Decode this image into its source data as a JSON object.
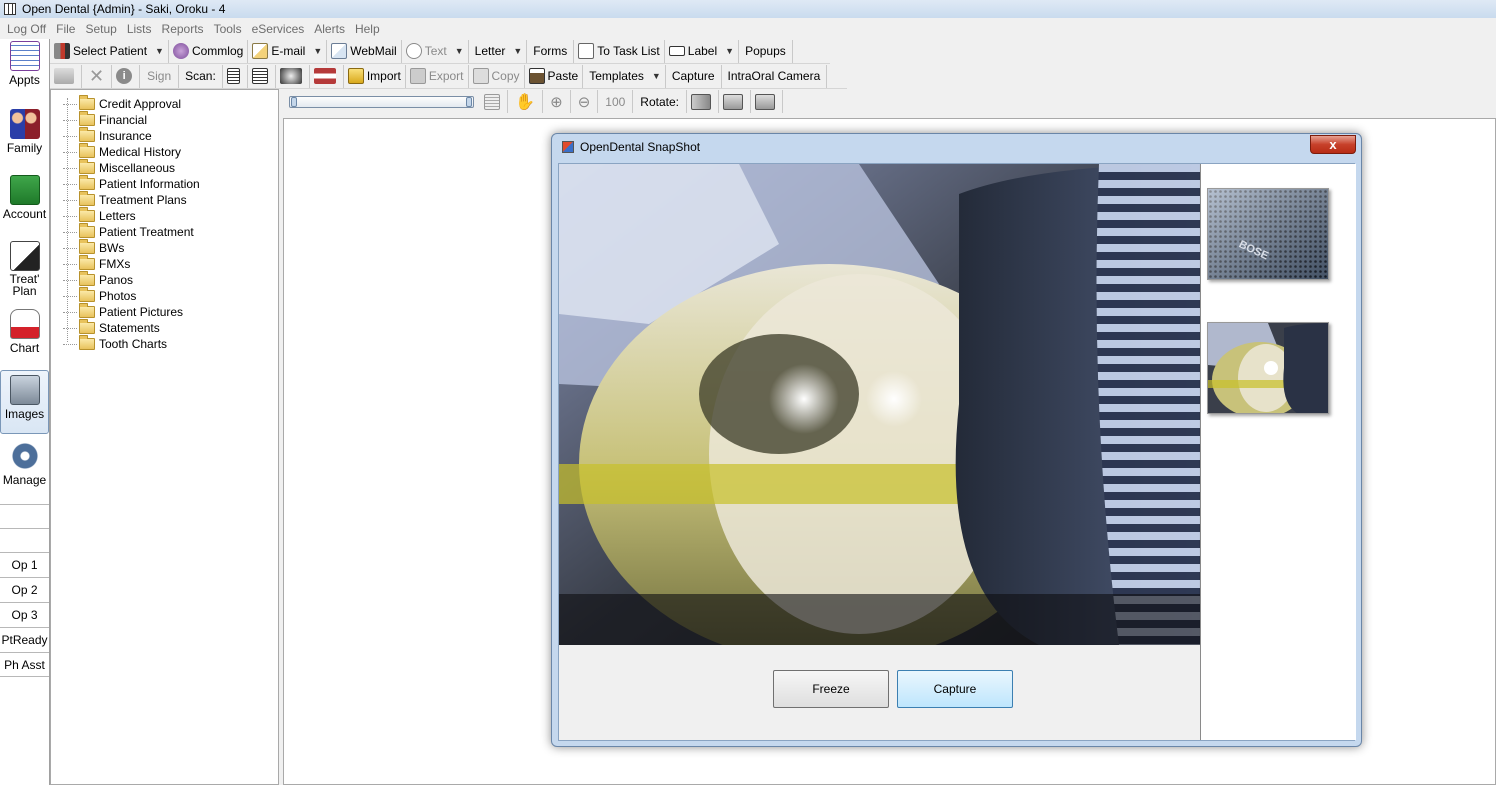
{
  "window": {
    "title": "Open Dental {Admin} - Saki, Oroku - 4"
  },
  "menu": [
    {
      "label": "Log Off"
    },
    {
      "label": "File"
    },
    {
      "label": "Setup"
    },
    {
      "label": "Lists"
    },
    {
      "label": "Reports"
    },
    {
      "label": "Tools"
    },
    {
      "label": "eServices"
    },
    {
      "label": "Alerts"
    },
    {
      "label": "Help"
    }
  ],
  "modules": [
    {
      "label": "Appts"
    },
    {
      "label": "Family"
    },
    {
      "label": "Account"
    },
    {
      "label": "Treat' Plan"
    },
    {
      "label": "Chart"
    },
    {
      "label": "Images"
    },
    {
      "label": "Manage"
    }
  ],
  "ops": [
    {
      "label": "Op 1"
    },
    {
      "label": "Op 2"
    },
    {
      "label": "Op 3"
    },
    {
      "label": "PtReady"
    },
    {
      "label": "Ph Asst"
    }
  ],
  "toolbar1": {
    "select_patient": "Select Patient",
    "commlog": "Commlog",
    "email": "E-mail",
    "webmail": "WebMail",
    "text": "Text",
    "letter": "Letter",
    "forms": "Forms",
    "task_list": "To Task List",
    "label": "Label",
    "popups": "Popups"
  },
  "toolbar2": {
    "sign": "Sign",
    "scan": "Scan:",
    "import": "Import",
    "export": "Export",
    "copy": "Copy",
    "paste": "Paste",
    "templates": "Templates",
    "capture": "Capture",
    "intraoral": "IntraOral Camera"
  },
  "toolbar3": {
    "zoom": "100",
    "rotate": "Rotate:"
  },
  "tree": [
    "Credit Approval",
    "Financial",
    "Insurance",
    "Medical History",
    "Miscellaneous",
    "Patient Information",
    "Treatment Plans",
    "Letters",
    "Patient Treatment",
    "BWs",
    "FMXs",
    "Panos",
    "Photos",
    "Patient Pictures",
    "Statements",
    "Tooth Charts"
  ],
  "dialog": {
    "title": "OpenDental SnapShot",
    "close": "x",
    "freeze": "Freeze",
    "capture": "Capture",
    "thumb1_brand": "BOSE"
  }
}
